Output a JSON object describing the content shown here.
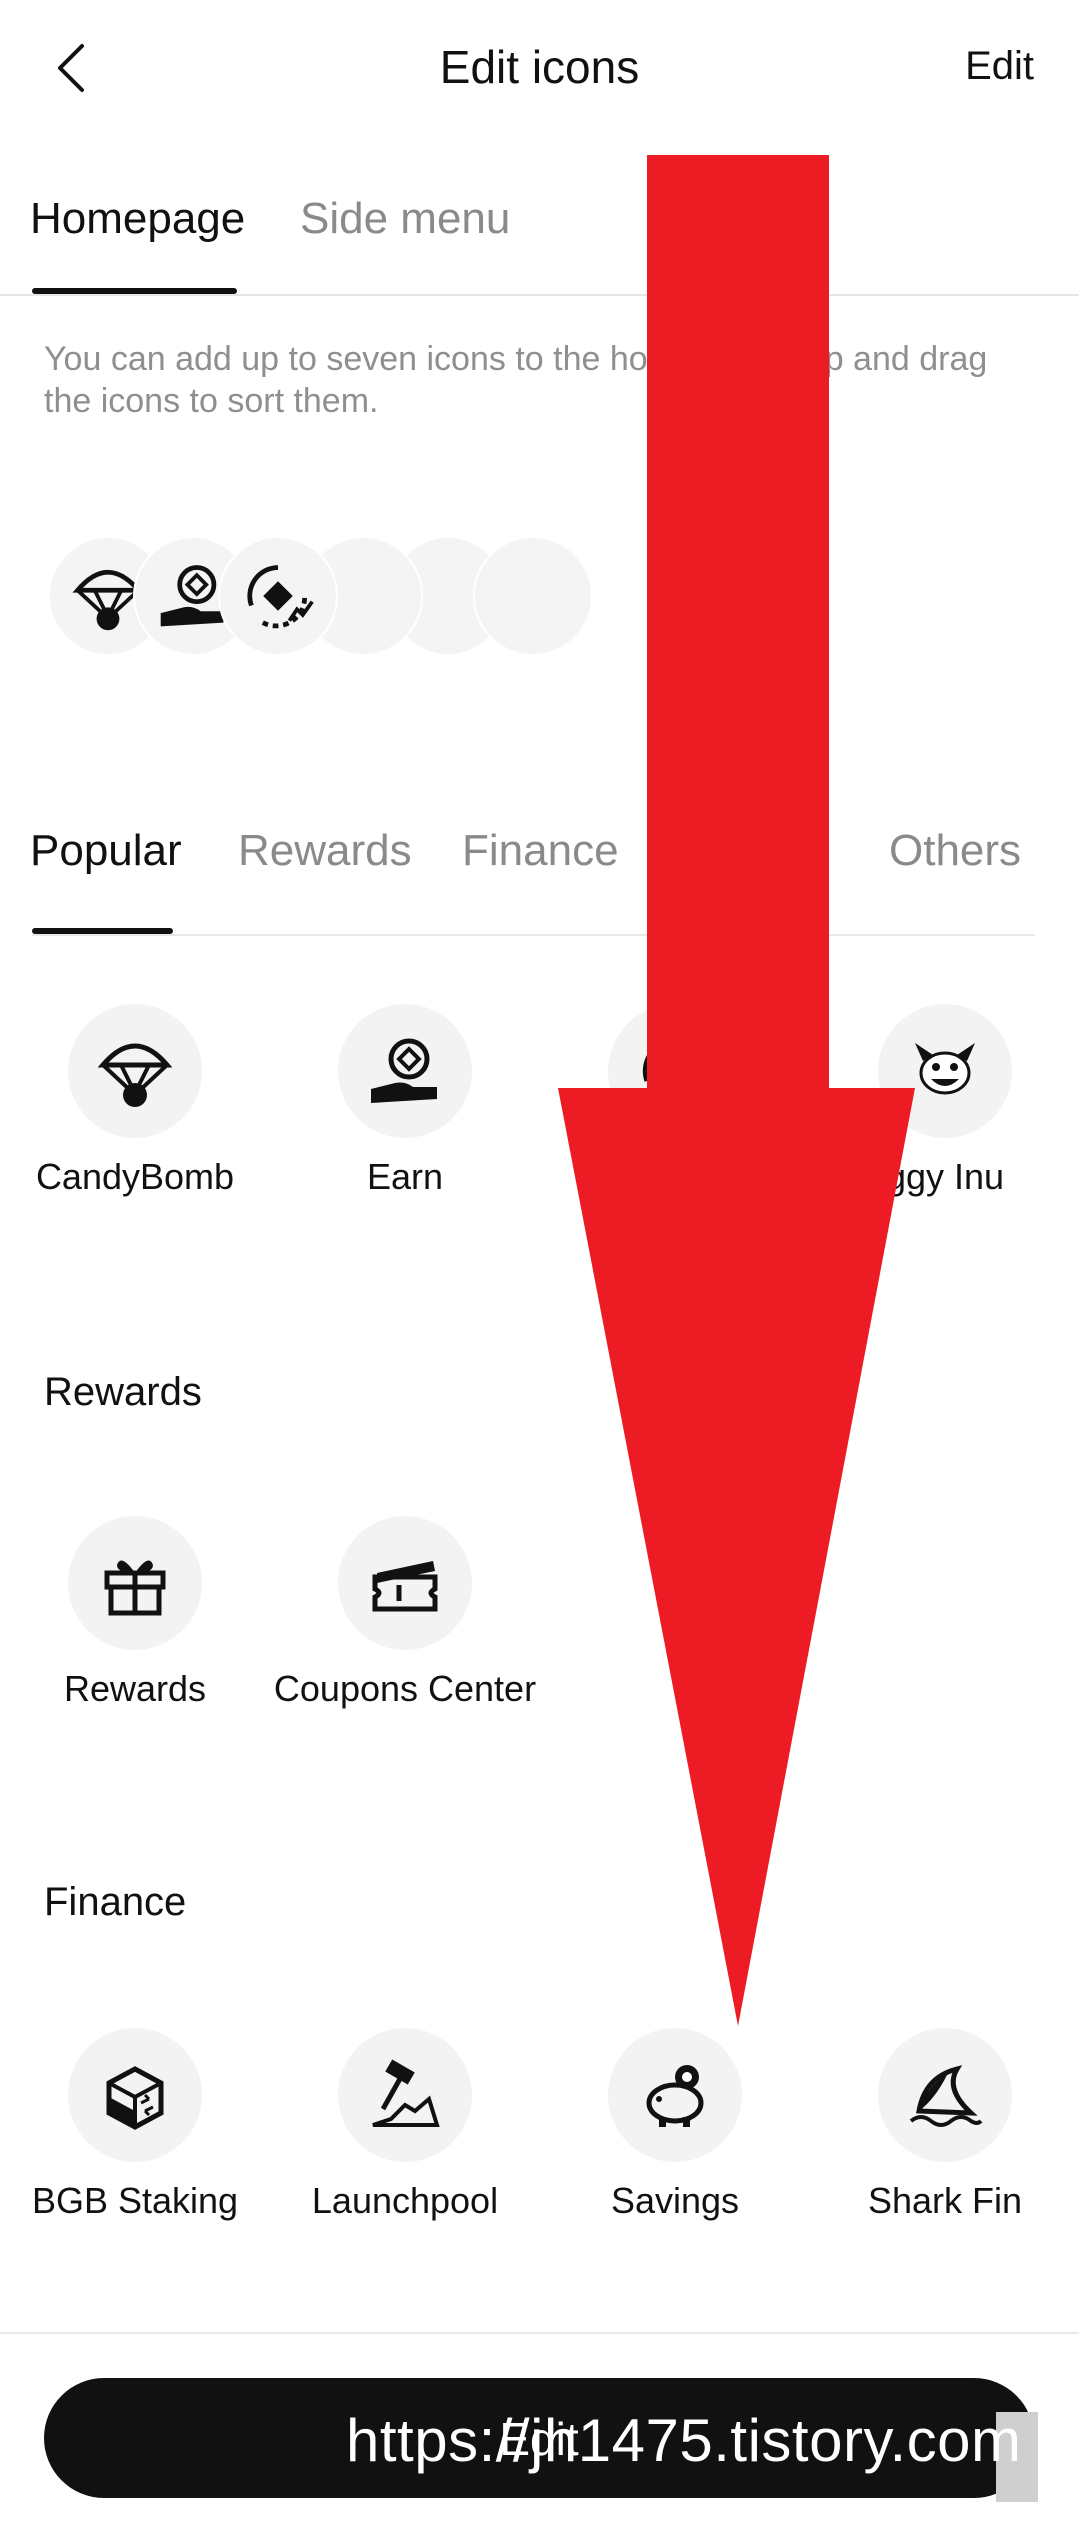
{
  "header": {
    "title": "Edit icons",
    "edit_label": "Edit",
    "back_icon": "chevron-left-icon"
  },
  "top_tabs": [
    {
      "label": "Homepage",
      "active": true
    },
    {
      "label": "Side menu",
      "active": false
    }
  ],
  "hint": "You can add up to seven icons to the homepage. Tap and drag the icons to sort them.",
  "selected_slots": {
    "filled": [
      "parachute-icon",
      "earn-icon",
      "crypto-swap-icon"
    ],
    "empty_count": 4
  },
  "category_tabs": [
    {
      "label": "Popular",
      "active": true
    },
    {
      "label": "Rewards",
      "active": false
    },
    {
      "label": "Finance",
      "active": false
    },
    {
      "label": "Others",
      "active": false
    }
  ],
  "sections": {
    "popular": {
      "items": [
        {
          "label": "CandyBomb",
          "icon": "parachute-icon"
        },
        {
          "label": "Earn",
          "icon": "earn-icon"
        },
        {
          "label": "",
          "icon": "crypto-swap-icon"
        },
        {
          "label": "ggy Inu",
          "icon": "doggy-inu-icon"
        }
      ]
    },
    "rewards": {
      "title": "Rewards",
      "items": [
        {
          "label": "Rewards",
          "icon": "gift-icon"
        },
        {
          "label": "Coupons Center",
          "icon": "coupon-icon"
        }
      ]
    },
    "finance": {
      "title": "Finance",
      "items": [
        {
          "label": "BGB Staking",
          "icon": "staking-icon"
        },
        {
          "label": "Launchpool",
          "icon": "launchpool-icon"
        },
        {
          "label": "Savings",
          "icon": "piggy-bank-icon"
        },
        {
          "label": "Shark Fin",
          "icon": "shark-fin-icon"
        }
      ]
    }
  },
  "bottom_button": {
    "label": "Edit"
  },
  "watermark": "https://jh1475.tistory.com",
  "colors": {
    "arrow": "#ed1c24",
    "button": "#111111",
    "muted": "#8a8a8a"
  }
}
